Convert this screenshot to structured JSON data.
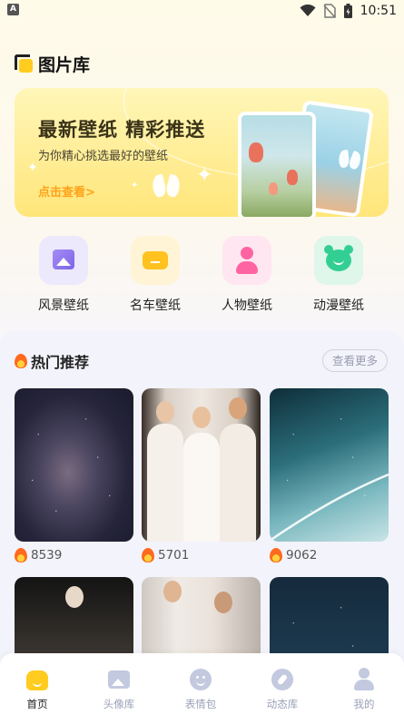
{
  "status_bar": {
    "time": "10:51",
    "notification_glyph": "A"
  },
  "header": {
    "title": "图片库"
  },
  "banner": {
    "title": "最新壁纸 精彩推送",
    "subtitle": "为你精心挑选最好的壁纸",
    "cta": "点击查看>"
  },
  "categories": [
    {
      "label": "风景壁纸",
      "icon": "landscape-icon",
      "bg": "#ebe9fb"
    },
    {
      "label": "名车壁纸",
      "icon": "car-icon",
      "bg": "#fff4d6"
    },
    {
      "label": "人物壁纸",
      "icon": "person-icon",
      "bg": "#ffe6f0"
    },
    {
      "label": "动漫壁纸",
      "icon": "anime-icon",
      "bg": "#dff6ea"
    }
  ],
  "hot": {
    "title": "热门推荐",
    "more_label": "查看更多",
    "items": [
      {
        "count": "8539",
        "image": "galaxy-night-sky"
      },
      {
        "count": "5701",
        "image": "fashion-models-runway"
      },
      {
        "count": "9062",
        "image": "milky-way-teal"
      },
      {
        "count": "",
        "image": "fashion-lace-gown"
      },
      {
        "count": "",
        "image": "fashion-runway-white"
      },
      {
        "count": "",
        "image": "night-sky-blue"
      }
    ]
  },
  "bottom_nav": [
    {
      "label": "首页",
      "icon": "home-icon",
      "active": true
    },
    {
      "label": "头像库",
      "icon": "image-icon",
      "active": false
    },
    {
      "label": "表情包",
      "icon": "emoji-icon",
      "active": false
    },
    {
      "label": "动态库",
      "icon": "compass-icon",
      "active": false
    },
    {
      "label": "我的",
      "icon": "profile-icon",
      "active": false
    }
  ],
  "colors": {
    "accent": "#ffcc1f",
    "cta": "#ffa21a",
    "nav_inactive": "#9aa0b8"
  }
}
